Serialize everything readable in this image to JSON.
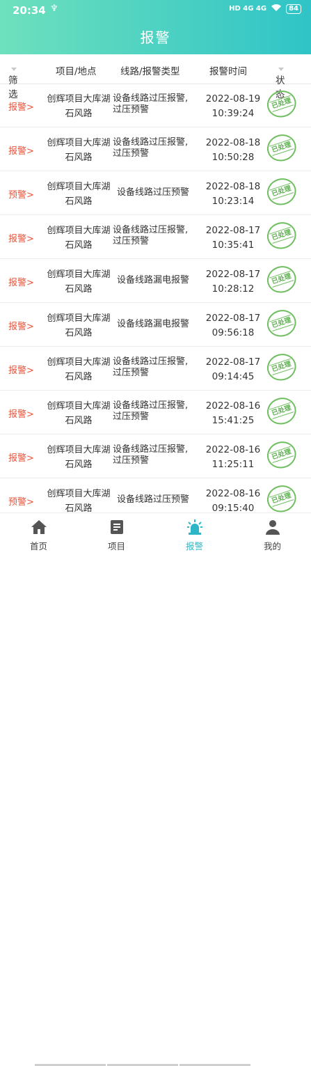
{
  "status": {
    "time": "20:34",
    "usb": "♆",
    "net": "HD 4G 4G",
    "battery": "84"
  },
  "header": {
    "title": "报警"
  },
  "table": {
    "headers": [
      "筛选",
      "项目/地点",
      "线路/报警类型",
      "报警时间",
      "状态"
    ]
  },
  "rows": [
    {
      "level": "报警>",
      "project_line1": "创辉项目大库湖",
      "project_line2": "石风路",
      "type_line1": "设备线路过压报警,",
      "type_line2": "过压预警",
      "date": "2022-08-19",
      "time": "10:39:24",
      "status": "已处理"
    },
    {
      "level": "报警>",
      "project_line1": "创辉项目大库湖",
      "project_line2": "石风路",
      "type_line1": "设备线路过压报警,",
      "type_line2": "过压预警",
      "date": "2022-08-18",
      "time": "10:50:28",
      "status": "已处理"
    },
    {
      "level": "预警>",
      "project_line1": "创辉项目大库湖",
      "project_line2": "石风路",
      "type_line1": "设备线路过压预警",
      "type_line2": "",
      "date": "2022-08-18",
      "time": "10:23:14",
      "status": "已处理"
    },
    {
      "level": "报警>",
      "project_line1": "创辉项目大库湖",
      "project_line2": "石风路",
      "type_line1": "设备线路过压报警,",
      "type_line2": "过压预警",
      "date": "2022-08-17",
      "time": "10:35:41",
      "status": "已处理"
    },
    {
      "level": "报警>",
      "project_line1": "创辉项目大库湖",
      "project_line2": "石风路",
      "type_line1": "设备线路漏电报警",
      "type_line2": "",
      "date": "2022-08-17",
      "time": "10:28:12",
      "status": "已处理"
    },
    {
      "level": "报警>",
      "project_line1": "创辉项目大库湖",
      "project_line2": "石风路",
      "type_line1": "设备线路漏电报警",
      "type_line2": "",
      "date": "2022-08-17",
      "time": "09:56:18",
      "status": "已处理"
    },
    {
      "level": "报警>",
      "project_line1": "创辉项目大库湖",
      "project_line2": "石风路",
      "type_line1": "设备线路过压报警,",
      "type_line2": "过压预警",
      "date": "2022-08-17",
      "time": "09:14:45",
      "status": "已处理"
    },
    {
      "level": "报警>",
      "project_line1": "创辉项目大库湖",
      "project_line2": "石风路",
      "type_line1": "设备线路过压报警,",
      "type_line2": "过压预警",
      "date": "2022-08-16",
      "time": "15:41:25",
      "status": "已处理"
    },
    {
      "level": "报警>",
      "project_line1": "创辉项目大库湖",
      "project_line2": "石风路",
      "type_line1": "设备线路过压报警,",
      "type_line2": "过压预警",
      "date": "2022-08-16",
      "time": "11:25:11",
      "status": "已处理"
    },
    {
      "level": "预警>",
      "project_line1": "创辉项目大库湖",
      "project_line2": "石风路",
      "type_line1": "设备线路过压预警",
      "type_line2": "",
      "date": "2022-08-16",
      "time": "09:15:40",
      "status": "已处理"
    }
  ],
  "tabs": [
    {
      "label": "首页",
      "icon": "home-icon",
      "active": false
    },
    {
      "label": "项目",
      "icon": "document-icon",
      "active": false
    },
    {
      "label": "报警",
      "icon": "alarm-light-icon",
      "active": true
    },
    {
      "label": "我的",
      "icon": "user-icon",
      "active": false
    }
  ],
  "colors": {
    "header_start": "#6ee0bd",
    "header_end": "#2fc4c7",
    "alarm": "#e8543a",
    "stamp": "#6fbf60",
    "tab_active": "#2db7c6"
  }
}
